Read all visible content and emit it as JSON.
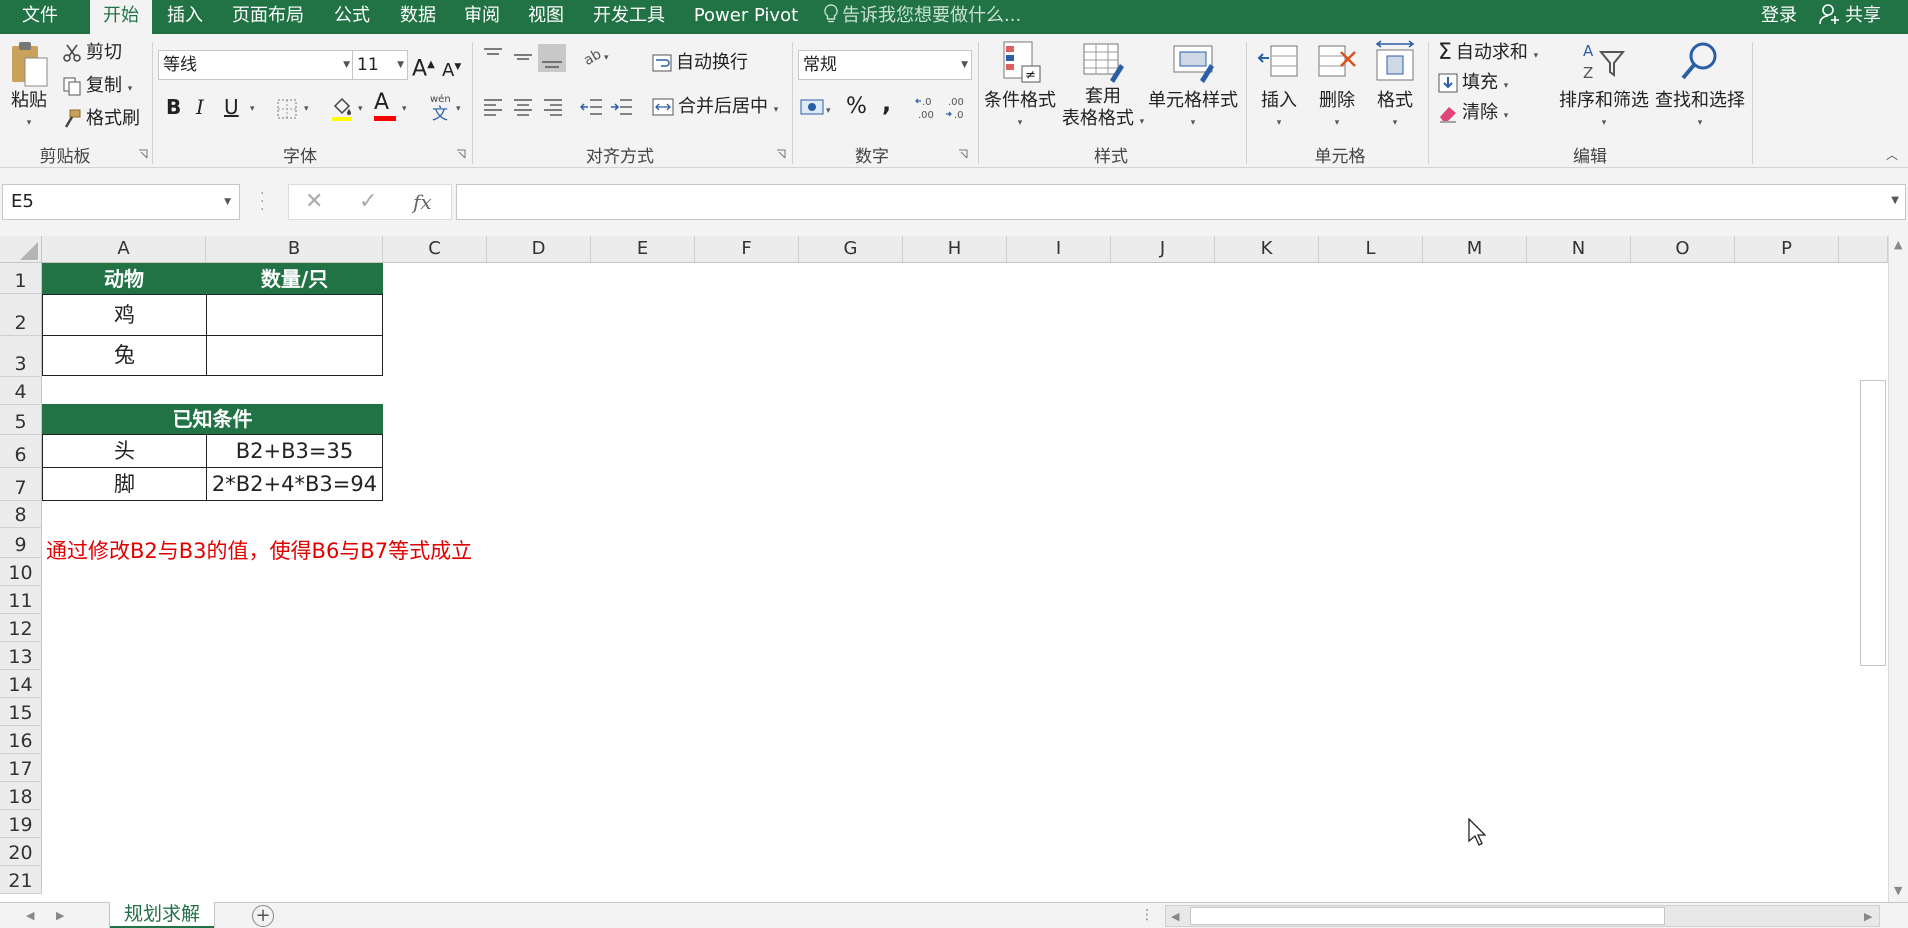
{
  "menu": {
    "items": [
      "文件",
      "开始",
      "插入",
      "页面布局",
      "公式",
      "数据",
      "审阅",
      "视图",
      "开发工具",
      "Power Pivot"
    ],
    "active_index": 1,
    "tell_me": "告诉我您想要做什么...",
    "login": "登录",
    "share": "共享"
  },
  "ribbon": {
    "clipboard": {
      "title": "剪贴板",
      "paste": "粘贴",
      "cut": "剪切",
      "copy": "复制",
      "format_painter": "格式刷"
    },
    "font": {
      "title": "字体",
      "font_name": "等线",
      "font_size": "11",
      "bold": "B",
      "italic": "I",
      "underline": "U"
    },
    "alignment": {
      "title": "对齐方式",
      "wrap_text": "自动换行",
      "merge_center": "合并后居中"
    },
    "number": {
      "title": "数字",
      "format": "常规",
      "percent": "%",
      "comma": ","
    },
    "styles": {
      "title": "样式",
      "conditional": "条件格式",
      "table_fmt_1": "套用",
      "table_fmt_2": "表格格式",
      "cell_styles": "单元格样式"
    },
    "cells": {
      "title": "单元格",
      "insert": "插入",
      "delete": "删除",
      "format": "格式"
    },
    "editing": {
      "title": "编辑",
      "autosum": "自动求和",
      "fill": "填充",
      "clear": "清除",
      "sort_filter": "排序和筛选",
      "find_select": "查找和选择"
    }
  },
  "formula_bar": {
    "name_box": "E5",
    "fx": "fx",
    "formula": ""
  },
  "columns": [
    "A",
    "B",
    "C",
    "D",
    "E",
    "F",
    "G",
    "H",
    "I",
    "J",
    "K",
    "L",
    "M",
    "N",
    "O",
    "P"
  ],
  "rows": [
    "1",
    "2",
    "3",
    "4",
    "5",
    "6",
    "7",
    "8",
    "9",
    "10",
    "11",
    "12",
    "13",
    "14",
    "15",
    "16",
    "17",
    "18",
    "19",
    "20",
    "21"
  ],
  "table1": {
    "header_animal": "动物",
    "header_count": "数量/只",
    "chicken": "鸡",
    "rabbit": "兔"
  },
  "table2": {
    "header": "已知条件",
    "head_label": "头",
    "head_formula": "B2+B3=35",
    "feet_label": "脚",
    "feet_formula": "2*B2+4*B3=94"
  },
  "note": "通过修改B2与B3的值，使得B6与B7等式成立",
  "sheet_tab": "规划求解",
  "colors": {
    "excel_green": "#217346",
    "note_red": "#e00000"
  }
}
